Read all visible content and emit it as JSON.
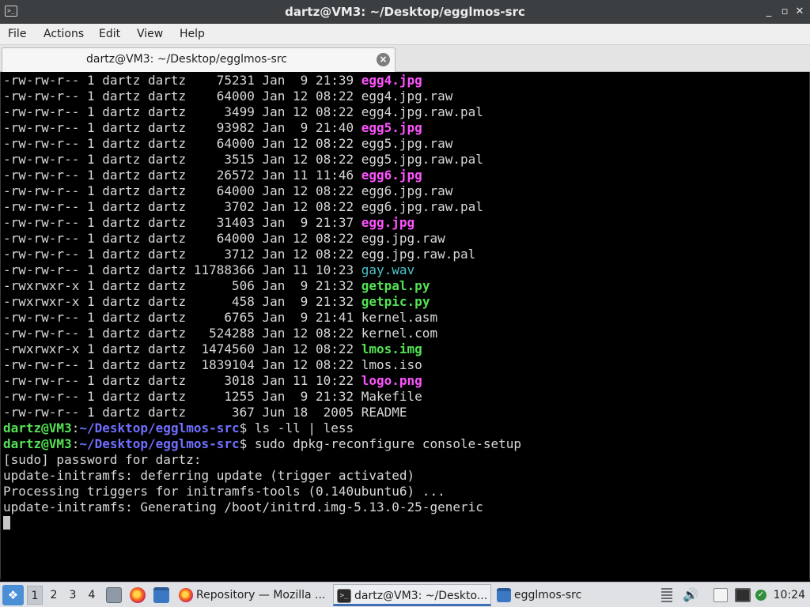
{
  "window": {
    "title": "dartz@VM3: ~/Desktop/egglmos-src",
    "minimize_icon": "_",
    "maximize_icon": "▫",
    "close_icon": "✕"
  },
  "menu": {
    "items": [
      "File",
      "Actions",
      "Edit",
      "View",
      "Help"
    ]
  },
  "tab": {
    "label": "dartz@VM3: ~/Desktop/egglmos-src",
    "close_glyph": "×"
  },
  "colors": {
    "image_file": "#ff54ff",
    "executable": "#54e354",
    "audio_file": "#4cc4cc",
    "prompt_user": "#54e354",
    "prompt_path": "#6f6fff",
    "text": "#d8d8d8"
  },
  "terminal": {
    "lines": [
      [
        {
          "t": "-rw-rw-r-- 1 dartz dartz    75231 Jan  9 21:39 "
        },
        {
          "t": "egg4.jpg",
          "c": "magenta"
        }
      ],
      [
        {
          "t": "-rw-rw-r-- 1 dartz dartz    64000 Jan 12 08:22 egg4.jpg.raw"
        }
      ],
      [
        {
          "t": "-rw-rw-r-- 1 dartz dartz     3499 Jan 12 08:22 egg4.jpg.raw.pal"
        }
      ],
      [
        {
          "t": "-rw-rw-r-- 1 dartz dartz    93982 Jan  9 21:40 "
        },
        {
          "t": "egg5.jpg",
          "c": "magenta"
        }
      ],
      [
        {
          "t": "-rw-rw-r-- 1 dartz dartz    64000 Jan 12 08:22 egg5.jpg.raw"
        }
      ],
      [
        {
          "t": "-rw-rw-r-- 1 dartz dartz     3515 Jan 12 08:22 egg5.jpg.raw.pal"
        }
      ],
      [
        {
          "t": "-rw-rw-r-- 1 dartz dartz    26572 Jan 11 11:46 "
        },
        {
          "t": "egg6.jpg",
          "c": "magenta"
        }
      ],
      [
        {
          "t": "-rw-rw-r-- 1 dartz dartz    64000 Jan 12 08:22 egg6.jpg.raw"
        }
      ],
      [
        {
          "t": "-rw-rw-r-- 1 dartz dartz     3702 Jan 12 08:22 egg6.jpg.raw.pal"
        }
      ],
      [
        {
          "t": "-rw-rw-r-- 1 dartz dartz    31403 Jan  9 21:37 "
        },
        {
          "t": "egg.jpg",
          "c": "magenta"
        }
      ],
      [
        {
          "t": "-rw-rw-r-- 1 dartz dartz    64000 Jan 12 08:22 egg.jpg.raw"
        }
      ],
      [
        {
          "t": "-rw-rw-r-- 1 dartz dartz     3712 Jan 12 08:22 egg.jpg.raw.pal"
        }
      ],
      [
        {
          "t": "-rw-rw-r-- 1 dartz dartz 11788366 Jan 11 10:23 "
        },
        {
          "t": "gay.wav",
          "c": "cyan"
        }
      ],
      [
        {
          "t": "-rwxrwxr-x 1 dartz dartz      506 Jan  9 21:32 "
        },
        {
          "t": "getpal.py",
          "c": "green"
        }
      ],
      [
        {
          "t": "-rwxrwxr-x 1 dartz dartz      458 Jan  9 21:32 "
        },
        {
          "t": "getpic.py",
          "c": "green"
        }
      ],
      [
        {
          "t": "-rw-rw-r-- 1 dartz dartz     6765 Jan  9 21:41 kernel.asm"
        }
      ],
      [
        {
          "t": "-rw-rw-r-- 1 dartz dartz   524288 Jan 12 08:22 kernel.com"
        }
      ],
      [
        {
          "t": "-rwxrwxr-x 1 dartz dartz  1474560 Jan 12 08:22 "
        },
        {
          "t": "lmos.img",
          "c": "green"
        }
      ],
      [
        {
          "t": "-rw-rw-r-- 1 dartz dartz  1839104 Jan 12 08:22 lmos.iso"
        }
      ],
      [
        {
          "t": "-rw-rw-r-- 1 dartz dartz     3018 Jan 11 10:22 "
        },
        {
          "t": "logo.png",
          "c": "magenta"
        }
      ],
      [
        {
          "t": "-rw-rw-r-- 1 dartz dartz     1255 Jan  9 21:32 Makefile"
        }
      ],
      [
        {
          "t": "-rw-rw-r-- 1 dartz dartz      367 Jun 18  2005 README"
        }
      ],
      [
        {
          "t": "dartz@VM3",
          "c": "prompt-user"
        },
        {
          "t": ":"
        },
        {
          "t": "~/Desktop/egglmos-src",
          "c": "prompt-path"
        },
        {
          "t": "$ ls -ll | less"
        }
      ],
      [
        {
          "t": "dartz@VM3",
          "c": "prompt-user"
        },
        {
          "t": ":"
        },
        {
          "t": "~/Desktop/egglmos-src",
          "c": "prompt-path"
        },
        {
          "t": "$ sudo dpkg-reconfigure console-setup"
        }
      ],
      [
        {
          "t": "[sudo] password for dartz:"
        }
      ],
      [
        {
          "t": "update-initramfs: deferring update (trigger activated)"
        }
      ],
      [
        {
          "t": "Processing triggers for initramfs-tools (0.140ubuntu6) ..."
        }
      ],
      [
        {
          "t": "update-initramfs: Generating /boot/initrd.img-5.13.0-25-generic"
        }
      ],
      [
        {
          "t": "",
          "cursor": true
        }
      ]
    ]
  },
  "taskbar": {
    "workspaces": [
      "1",
      "2",
      "3",
      "4"
    ],
    "tasks": [
      {
        "label": "Repository — Mozilla ...",
        "icon": "firefox-icon"
      },
      {
        "label": "dartz@VM3: ~/Deskto...",
        "icon": "terminal-icon"
      },
      {
        "label": "egglmos-src",
        "icon": "folder-icon"
      }
    ],
    "clock": "10:24"
  }
}
